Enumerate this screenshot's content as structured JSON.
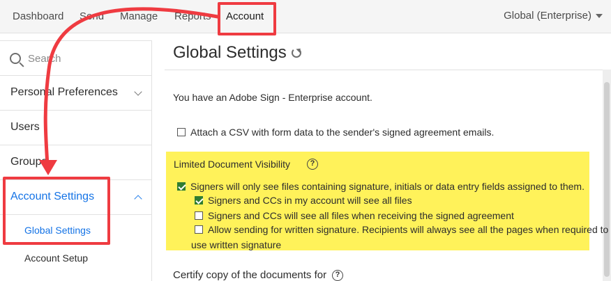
{
  "topnav": {
    "items": [
      "Dashboard",
      "Send",
      "Manage",
      "Reports",
      "Account"
    ],
    "account_switch": "Global (Enterprise)"
  },
  "sidebar": {
    "search_placeholder": "Search",
    "items": [
      "Personal Preferences",
      "Users",
      "Groups",
      "Account Settings"
    ],
    "sub_items": [
      "Global Settings",
      "Account Setup"
    ]
  },
  "main": {
    "title": "Global Settings",
    "account_line": "You have an Adobe Sign - Enterprise account.",
    "attach_csv": "Attach a CSV with form data to the sender's signed agreement emails.",
    "ldv": {
      "heading": "Limited Document Visibility",
      "opt_main": "Signers will only see files containing signature, initials or data entry fields assigned to them.",
      "opt_1": "Signers and CCs in my account will see all files",
      "opt_2": "Signers and CCs will see all files when receiving the signed agreement",
      "opt_3a": "Allow sending for written signature. Recipients will always see all the pages when required to",
      "opt_3b": "use written signature"
    },
    "certify_heading": "Certify copy of the documents for",
    "help_glyph": "?"
  },
  "colors": {
    "annotation": "#ef3b41",
    "highlight": "#fff25a",
    "accent": "#1473e6",
    "checkbox": "#2f7d32"
  }
}
